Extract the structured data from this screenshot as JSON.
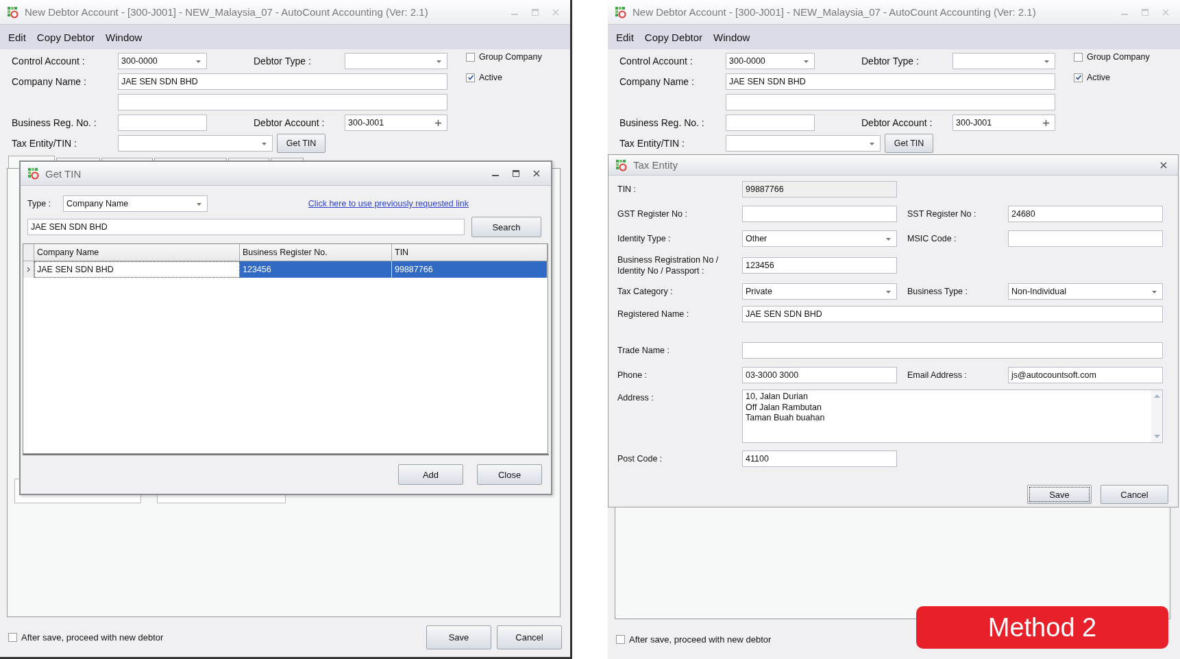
{
  "windows": [
    {
      "title": "New Debtor Account - [300-J001] - NEW_Malaysia_07 - AutoCount Accounting (Ver: 2.1)",
      "menu": [
        "Edit",
        "Copy Debtor",
        "Window"
      ],
      "form": {
        "control_account": {
          "label": "Control Account :",
          "value": "300-0000"
        },
        "debtor_type": {
          "label": "Debtor Type :"
        },
        "group_company": {
          "label": "Group Company",
          "checked": false
        },
        "active": {
          "label": "Active",
          "checked": true
        },
        "company_name": {
          "label": "Company Name :",
          "value": "JAE SEN SDN BHD"
        },
        "business_reg_no": {
          "label": "Business Reg. No. :"
        },
        "debtor_account": {
          "label": "Debtor Account :",
          "value": "300-J001"
        },
        "tax_entity": {
          "label": "Tax Entity/TIN :"
        },
        "get_tin_button": "Get TIN"
      },
      "tabs": [
        {
          "selected": true
        },
        {
          "selected": false
        },
        {
          "selected": false
        },
        {
          "selected": false
        },
        {
          "selected": false
        },
        {
          "selected": false
        }
      ],
      "panel_fields": [
        {
          "kind": "text"
        },
        {
          "kind": "text"
        }
      ],
      "footer": {
        "proceed_new": {
          "label": "After save, proceed with new debtor",
          "checked": false
        },
        "buttons": [
          "Save",
          "Cancel"
        ]
      },
      "dialog": {
        "kind": "get_tin",
        "title": "Get TIN",
        "type": {
          "label": "Type :",
          "value": "Company Name"
        },
        "link": "Click here to use previously requested link",
        "search": {
          "value": "JAE SEN SDN BHD"
        },
        "search_button": "Search",
        "columns": [
          "Company Name",
          "Business Register No.",
          "TIN"
        ],
        "rows": [
          {
            "cells": [
              "JAE SEN SDN BHD",
              "123456",
              "99887766"
            ],
            "selected": true
          }
        ],
        "buttons": [
          "Add",
          "Close"
        ]
      }
    },
    {
      "title": "New Debtor Account - [300-J001] - NEW_Malaysia_07 - AutoCount Accounting (Ver: 2.1)",
      "menu": [
        "Edit",
        "Copy Debtor",
        "Window"
      ],
      "form": {
        "control_account": {
          "label": "Control Account :",
          "value": "300-0000"
        },
        "debtor_type": {
          "label": "Debtor Type :"
        },
        "group_company": {
          "label": "Group Company",
          "checked": false
        },
        "active": {
          "label": "Active",
          "checked": true
        },
        "company_name": {
          "label": "Company Name :",
          "value": "JAE SEN SDN BHD"
        },
        "business_reg_no": {
          "label": "Business Reg. No. :"
        },
        "debtor_account": {
          "label": "Debtor Account :",
          "value": "300-J001"
        },
        "tax_entity": {
          "label": "Tax Entity/TIN :"
        },
        "get_tin_button": "Get TIN"
      },
      "footer": {
        "proceed_new": {
          "label": "After save, proceed with new debtor",
          "checked": false
        }
      },
      "dialog": {
        "kind": "tax_entity",
        "title": "Tax Entity",
        "rows": [
          {
            "cells": [
              {
                "label": "TIN :",
                "value": "99887766",
                "kind": "readonly"
              }
            ]
          },
          {
            "cells": [
              {
                "label": "GST Register No :",
                "kind": "text"
              },
              {
                "label": "SST Register No :",
                "value": "24680",
                "kind": "text"
              }
            ]
          },
          {
            "cells": [
              {
                "label": "Identity Type :",
                "value": "Other",
                "kind": "dropdown"
              },
              {
                "label": "MSIC Code :",
                "kind": "text"
              }
            ]
          },
          {
            "cells": [
              {
                "label": "Business Registration No / Identity No / Passport :",
                "value": "123456",
                "kind": "text"
              }
            ]
          },
          {
            "cells": [
              {
                "label": "Tax Category :",
                "value": "Private",
                "kind": "dropdown"
              },
              {
                "label": "Business Type :",
                "value": "Non-Individual",
                "kind": "dropdown"
              }
            ]
          },
          {
            "cells": [
              {
                "label": "Registered Name :",
                "value": "JAE SEN SDN BHD",
                "kind": "line"
              }
            ]
          },
          {
            "cells": [
              {
                "label": "Trade Name :",
                "kind": "line"
              }
            ]
          },
          {
            "cells": [
              {
                "label": "Phone :",
                "value": "03-3000 3000",
                "kind": "text"
              },
              {
                "label": "Email Address :",
                "value": "js@autocountsoft.com",
                "kind": "text"
              }
            ]
          },
          {
            "cells": [
              {
                "label": "Address :",
                "value": "10, Jalan Durian\nOff Jalan Rambutan\nTaman Buah buahan",
                "kind": "memo"
              }
            ]
          },
          {
            "cells": [
              {
                "label": "Post Code :",
                "value": "41100",
                "kind": "text"
              }
            ]
          }
        ],
        "buttons": [
          "Save",
          "Cancel"
        ]
      },
      "annotation": {
        "text": "Method 2"
      }
    }
  ]
}
